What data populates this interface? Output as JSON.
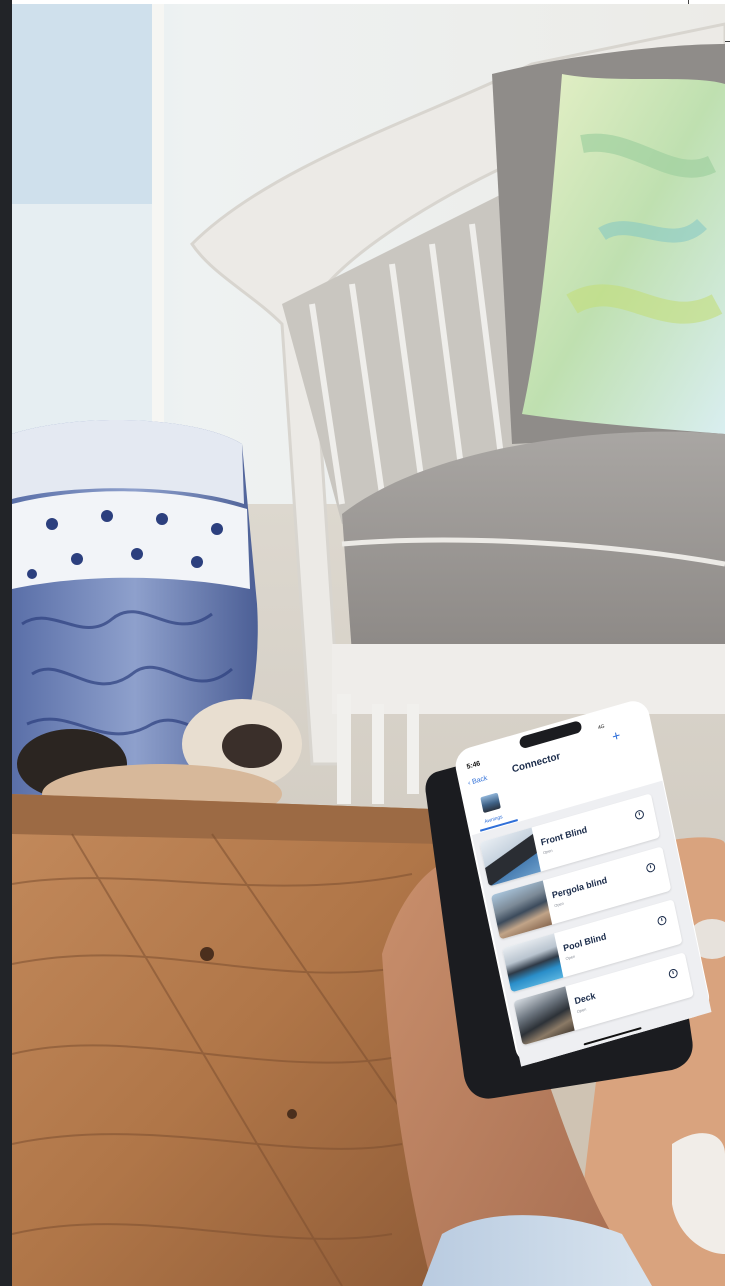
{
  "app": {
    "status_time": "5:46",
    "status_icons": "4G",
    "back_label": "Back",
    "title": "Connector",
    "add_symbol": "+",
    "tab_label": "Awnings"
  },
  "devices": [
    {
      "name": "Front Blind",
      "status": "Open"
    },
    {
      "name": "Pergola blind",
      "status": "Open"
    },
    {
      "name": "Pool Blind",
      "status": "Open"
    },
    {
      "name": "Deck",
      "status": "Open"
    }
  ],
  "icons": {
    "back": "chevron-left-icon",
    "add": "plus-icon",
    "timer": "clock-icon"
  },
  "colors": {
    "accent": "#2f6fd8",
    "title_text": "#1a2b4a",
    "list_background": "#eeeff2",
    "table_wood": "#b47a4f",
    "cushion": "#9a9694"
  }
}
